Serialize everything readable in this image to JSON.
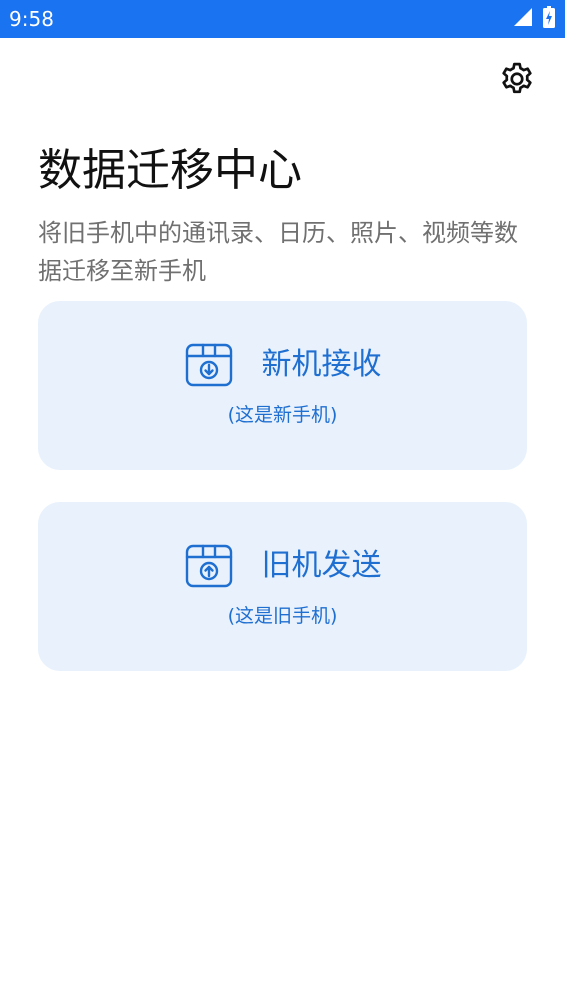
{
  "status_bar": {
    "time": "9:58",
    "background": "#1a73f0",
    "icons": [
      "signal-icon",
      "battery-charging-icon"
    ]
  },
  "header": {
    "settings_icon": "gear-icon"
  },
  "main": {
    "title": "数据迁移中心",
    "description": "将旧手机中的通讯录、日历、照片、视频等数据迁移至新手机"
  },
  "cards": {
    "receive": {
      "icon": "box-download-icon",
      "title": "新机接收",
      "subtitle": "(这是新手机)"
    },
    "send": {
      "icon": "box-upload-icon",
      "title": "旧机发送",
      "subtitle": "(这是旧手机)"
    }
  },
  "colors": {
    "accent": "#1f6fd1",
    "card_background": "#e8f1fc",
    "title_text": "#111111",
    "description_text": "#707070"
  }
}
